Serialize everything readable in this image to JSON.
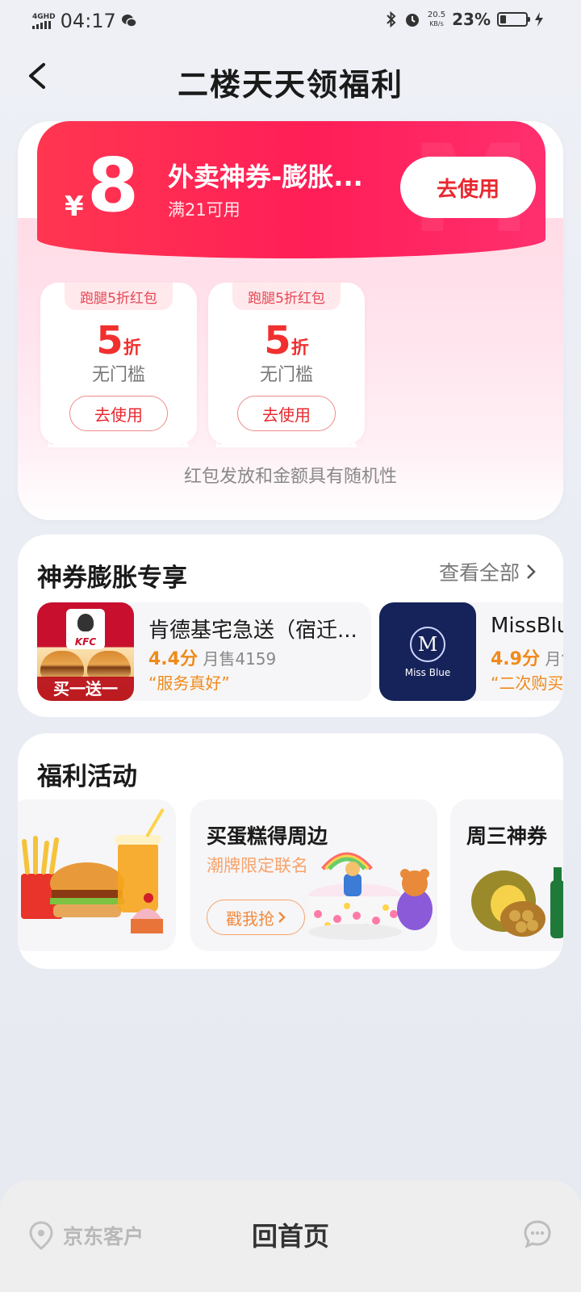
{
  "status_bar": {
    "network": "4GHD",
    "time": "04:17",
    "speed_value": "20.5",
    "speed_unit": "KB/s",
    "battery_percent": "23%",
    "battery_level": 0.23
  },
  "header": {
    "title": "二楼天天领福利"
  },
  "top_coupon": {
    "currency": "¥",
    "amount": "8",
    "name": "外卖神券-膨胀...",
    "condition": "满21可用",
    "use_label": "去使用"
  },
  "small_coupons": [
    {
      "tag": "跑腿5折红包",
      "value": "5",
      "unit": "折",
      "condition": "无门槛",
      "use_label": "去使用"
    },
    {
      "tag": "跑腿5折红包",
      "value": "5",
      "unit": "折",
      "condition": "无门槛",
      "use_label": "去使用"
    }
  ],
  "coupon_note": "红包发放和金额具有随机性",
  "exclusive": {
    "title": "神券膨胀专享",
    "view_all": "查看全部",
    "stores": [
      {
        "name": "肯德基宅急送（宿迁...",
        "rating": "4.4分",
        "sales": "月售4159",
        "quote": "“服务真好”",
        "logo_text": "KFC",
        "promo": "买一送一"
      },
      {
        "name": "MissBlue",
        "rating": "4.9分",
        "sales": "月售",
        "quote": "“二次购买",
        "logo_text": "M",
        "brand": "Miss Blue"
      }
    ]
  },
  "activities": {
    "title": "福利活动",
    "items": [
      {
        "title": "",
        "subtitle": "",
        "button": ""
      },
      {
        "title": "买蛋糕得周边",
        "subtitle": "潮牌限定联名",
        "button": "戳我抢"
      },
      {
        "title": "周三神券",
        "subtitle": "",
        "button": ""
      }
    ]
  },
  "bottom_bar": {
    "location_label": "京东客户",
    "home_label": "回首页"
  },
  "colors": {
    "accent_red": "#ff2a55",
    "coupon_text_red": "#e8282f",
    "orange": "#f08a1a",
    "background": "#eef0f6"
  }
}
